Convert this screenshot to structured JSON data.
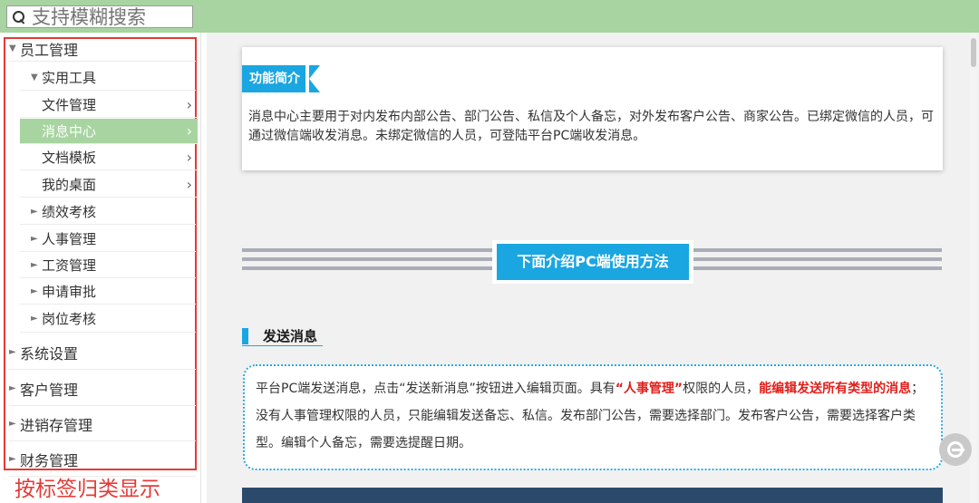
{
  "search": {
    "placeholder": "支持模糊搜索"
  },
  "sidebar": {
    "caption": "按标签归类显示",
    "items": [
      {
        "label": "员工管理",
        "level": 0,
        "arrow": "▼",
        "chevron": ""
      },
      {
        "label": "实用工具",
        "level": 1,
        "arrow": "▼",
        "chevron": ""
      },
      {
        "label": "文件管理",
        "level": 2,
        "arrow": "",
        "chevron": "›"
      },
      {
        "label": "消息中心",
        "level": 2,
        "arrow": "",
        "chevron": "›",
        "active": true
      },
      {
        "label": "文档模板",
        "level": 2,
        "arrow": "",
        "chevron": "›"
      },
      {
        "label": "我的桌面",
        "level": 2,
        "arrow": "",
        "chevron": "›"
      },
      {
        "label": "绩效考核",
        "level": 1,
        "arrow": "►",
        "chevron": ""
      },
      {
        "label": "人事管理",
        "level": 1,
        "arrow": "►",
        "chevron": ""
      },
      {
        "label": "工资管理",
        "level": 1,
        "arrow": "►",
        "chevron": ""
      },
      {
        "label": "申请审批",
        "level": 1,
        "arrow": "►",
        "chevron": ""
      },
      {
        "label": "岗位考核",
        "level": 1,
        "arrow": "►",
        "chevron": ""
      },
      {
        "label": "系统设置",
        "level": 0,
        "arrow": "►",
        "chevron": ""
      },
      {
        "label": "客户管理",
        "level": 0,
        "arrow": "►",
        "chevron": ""
      },
      {
        "label": "进销存管理",
        "level": 0,
        "arrow": "►",
        "chevron": ""
      },
      {
        "label": "财务管理",
        "level": 0,
        "arrow": "►",
        "chevron": ""
      }
    ]
  },
  "main": {
    "intro": {
      "tag": "功能简介",
      "text": "消息中心主要用于对内发布内部公告、部门公告、私信及个人备忘，对外发布客户公告、商家公告。已绑定微信的人员，可通过微信端收发消息。未绑定微信的人员，可登陆平台PC端收发消息。"
    },
    "banner": "下面介绍PC端使用方法",
    "section_title": "发送消息",
    "card": {
      "p1": "平台PC端发送消息，点击“发送新消息”按钮进入编辑页面。具有",
      "hl1": "“人事管理”",
      "p2": "权限的人员，",
      "hl2": "能编辑发送所有类型的消息",
      "p3": "；没有人事管理权限的人员，只能编辑发送备忘、私信。发布部门公告，需要选择部门。发布客户公告，需要选择客户类型。编辑个人备忘，需要选提醒日期。"
    }
  },
  "colors": {
    "accent": "#1aa6e0",
    "topbar": "#a7d4a0",
    "highlight": "#e0201c",
    "annotation": "#e53935"
  },
  "icons": {
    "search": "search-icon",
    "float": "sogou-logo-icon"
  }
}
